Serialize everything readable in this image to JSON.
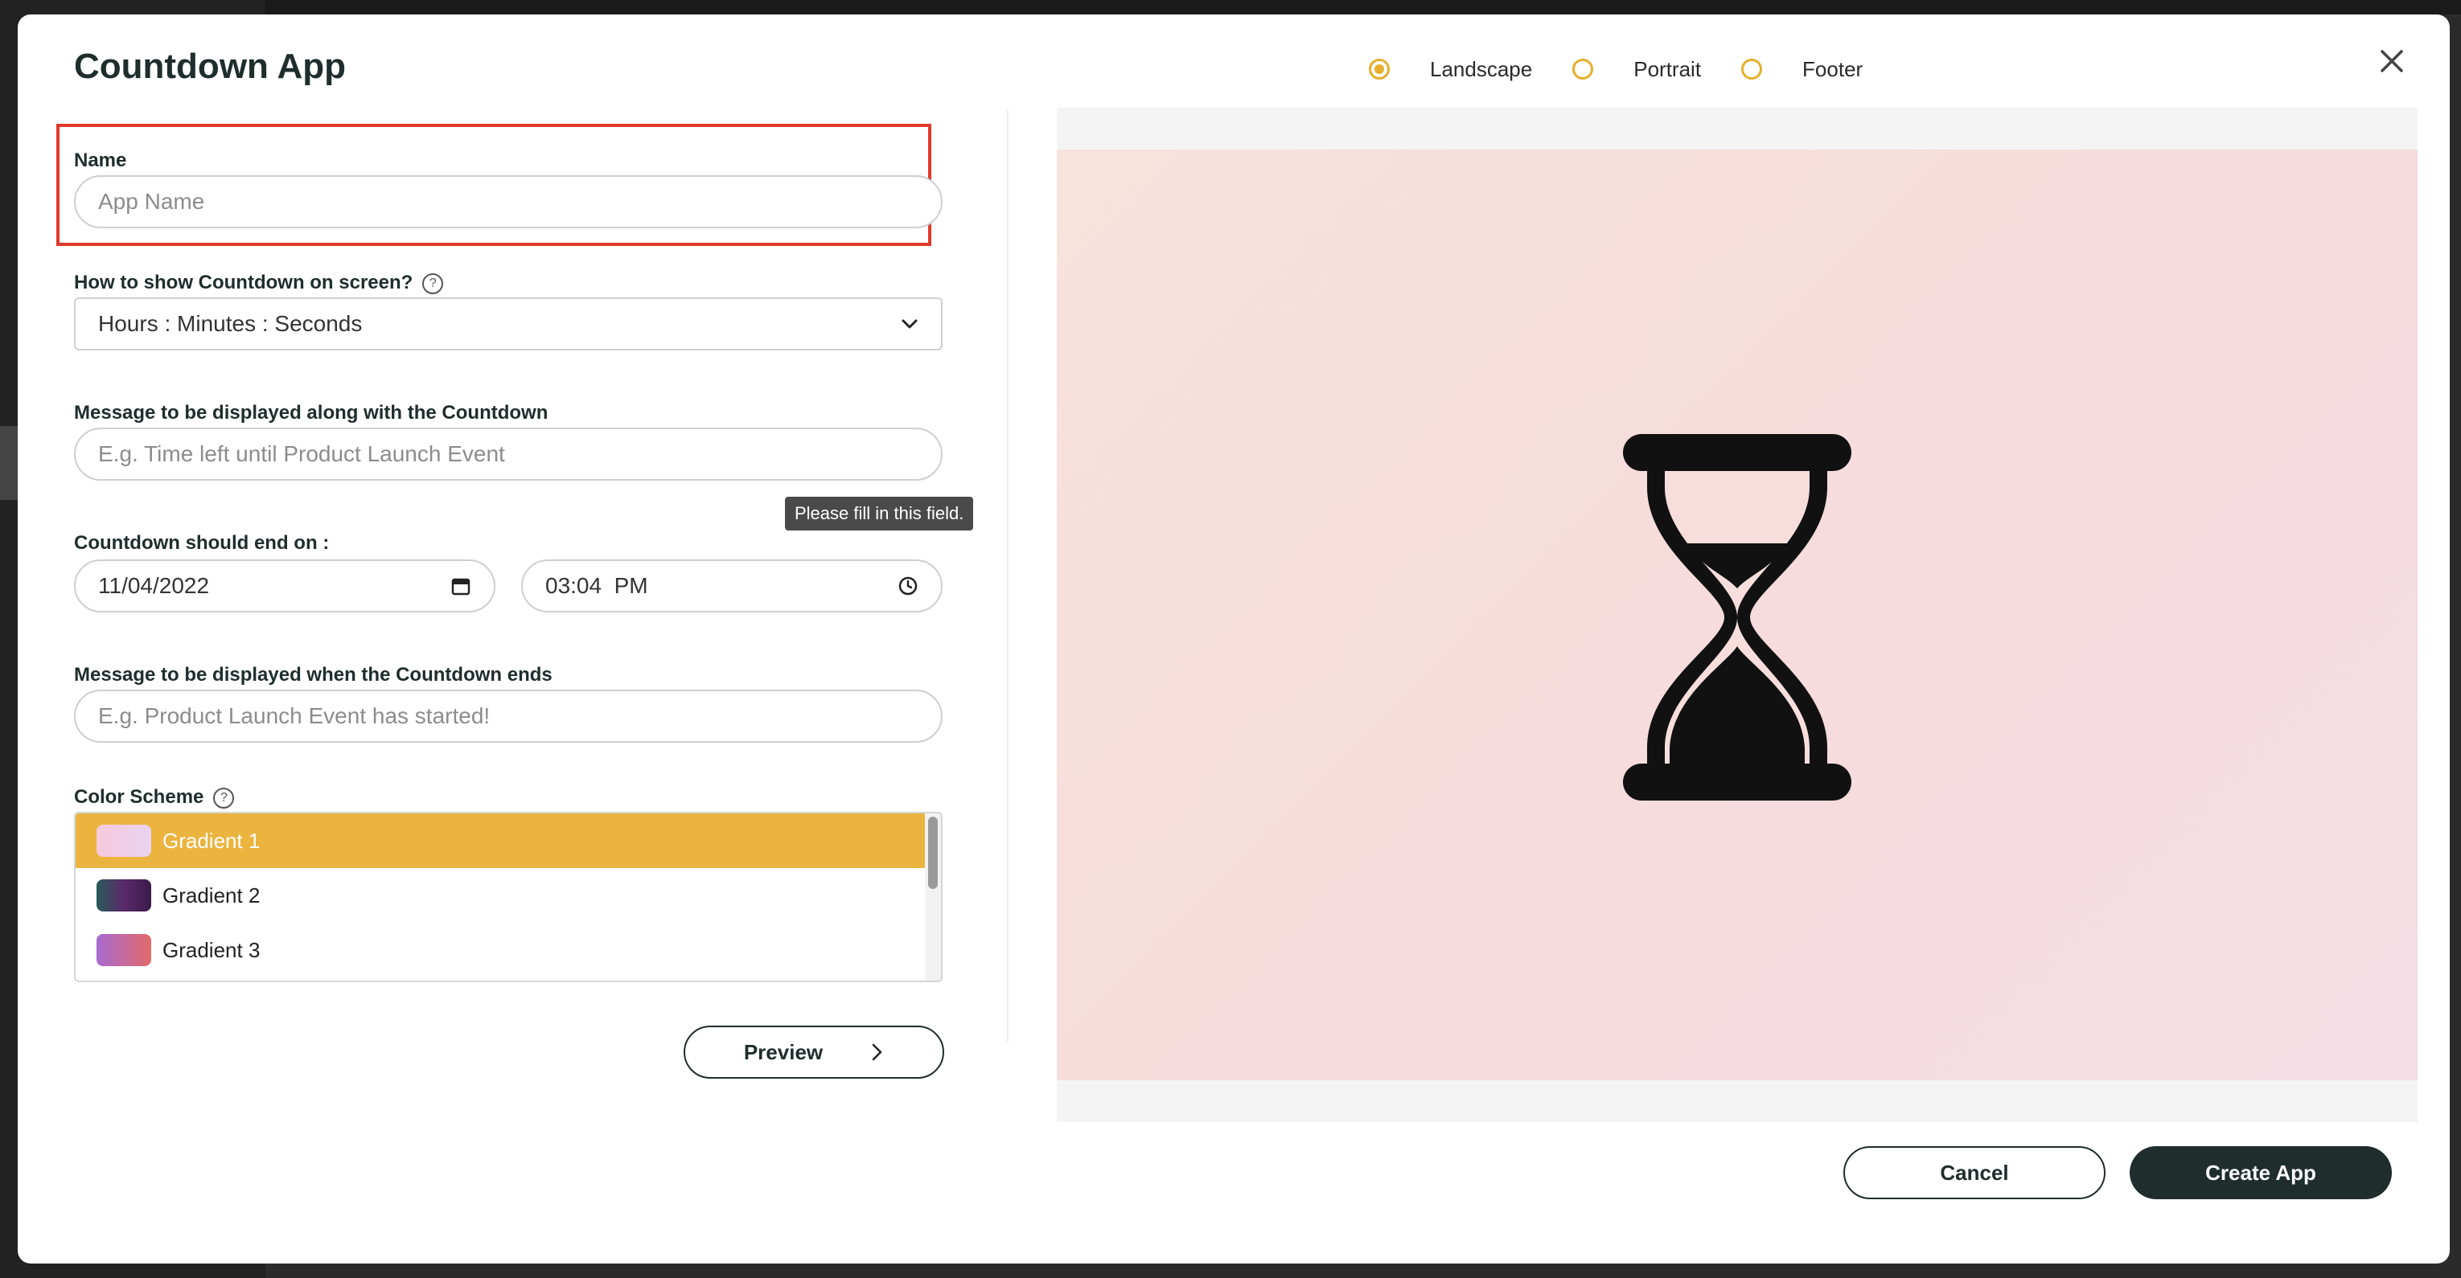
{
  "modal": {
    "title": "Countdown App"
  },
  "orientation": {
    "options": [
      "Landscape",
      "Portrait",
      "Footer"
    ],
    "selected": "Landscape",
    "accent_color": "#e6ae2c"
  },
  "form": {
    "name": {
      "label": "Name",
      "placeholder": "App Name"
    },
    "display_format": {
      "label": "How to show Countdown on screen?",
      "value": "Hours : Minutes : Seconds"
    },
    "message_during": {
      "label": "Message to be displayed along with the Countdown",
      "placeholder": "E.g. Time left until Product Launch Event"
    },
    "validation_tooltip": "Please fill in this field.",
    "end_on": {
      "label": "Countdown should end on :",
      "date": "11/04/2022",
      "time": "03:04  PM"
    },
    "message_end": {
      "label": "Message to be displayed when the Countdown ends",
      "placeholder": "E.g. Product Launch Event has started!"
    },
    "color_scheme": {
      "label": "Color Scheme",
      "options": [
        "Gradient 1",
        "Gradient 2",
        "Gradient 3"
      ],
      "selected": "Gradient 1",
      "highlight_color": "#ebb43f"
    },
    "preview_button": "Preview"
  },
  "actions": {
    "cancel": "Cancel",
    "create": "Create App"
  },
  "icons": {
    "close": "close-icon",
    "help": "help-circle-icon",
    "chevron": "chevron-down-icon",
    "calendar": "calendar-icon",
    "clock": "clock-icon",
    "arrow": "chevron-right-icon",
    "preview": "hourglass-icon"
  }
}
